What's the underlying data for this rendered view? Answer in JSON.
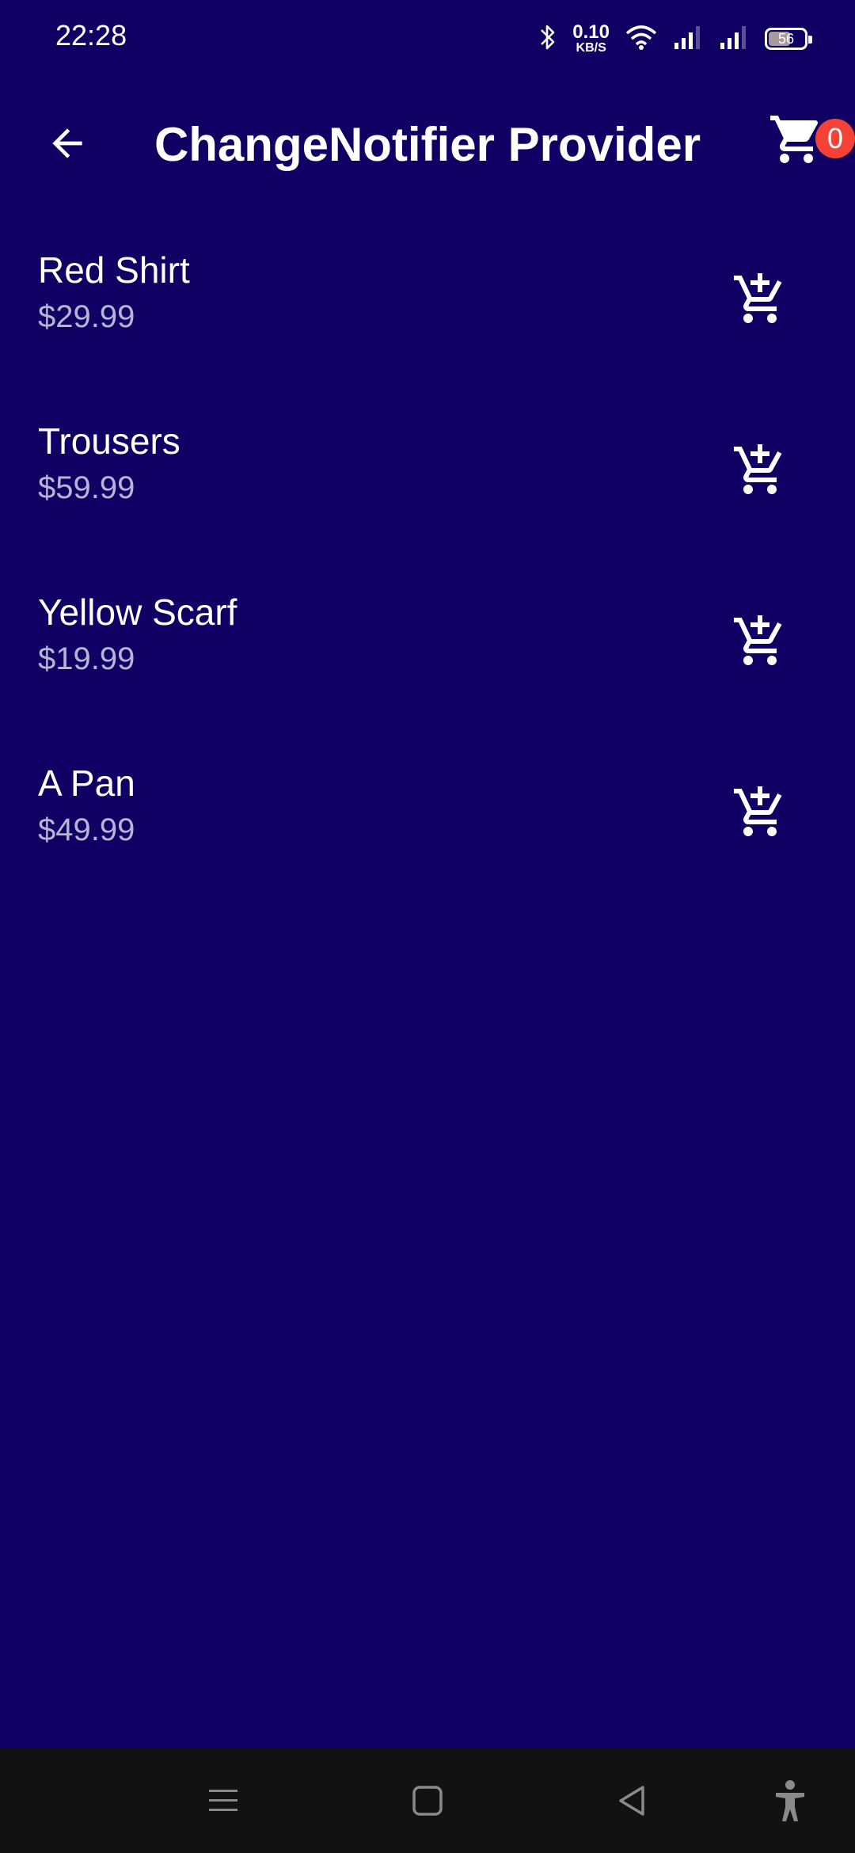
{
  "status_bar": {
    "time": "22:28",
    "net_speed_value": "0.10",
    "net_speed_unit": "KB/S",
    "battery_level": "56",
    "icons": [
      "bluetooth-icon",
      "wifi-icon",
      "signal-icon",
      "signal-icon",
      "battery-icon"
    ]
  },
  "app_bar": {
    "title": "ChangeNotifier Provider",
    "back_icon": "arrow-back-icon",
    "cart_icon": "shopping-cart-icon",
    "cart_count": "0"
  },
  "products": [
    {
      "name": "Red Shirt",
      "price": "$29.99"
    },
    {
      "name": "Trousers",
      "price": "$59.99"
    },
    {
      "name": "Yellow Scarf",
      "price": "$19.99"
    },
    {
      "name": "A Pan",
      "price": "$49.99"
    }
  ],
  "colors": {
    "background": "#100064",
    "badge": "#f44336",
    "price_text": "#b8b4d8",
    "nav_bar": "#121212"
  },
  "nav_bar": {
    "icons": [
      "menu-icon",
      "home-square-icon",
      "back-triangle-icon",
      "accessibility-icon"
    ]
  }
}
